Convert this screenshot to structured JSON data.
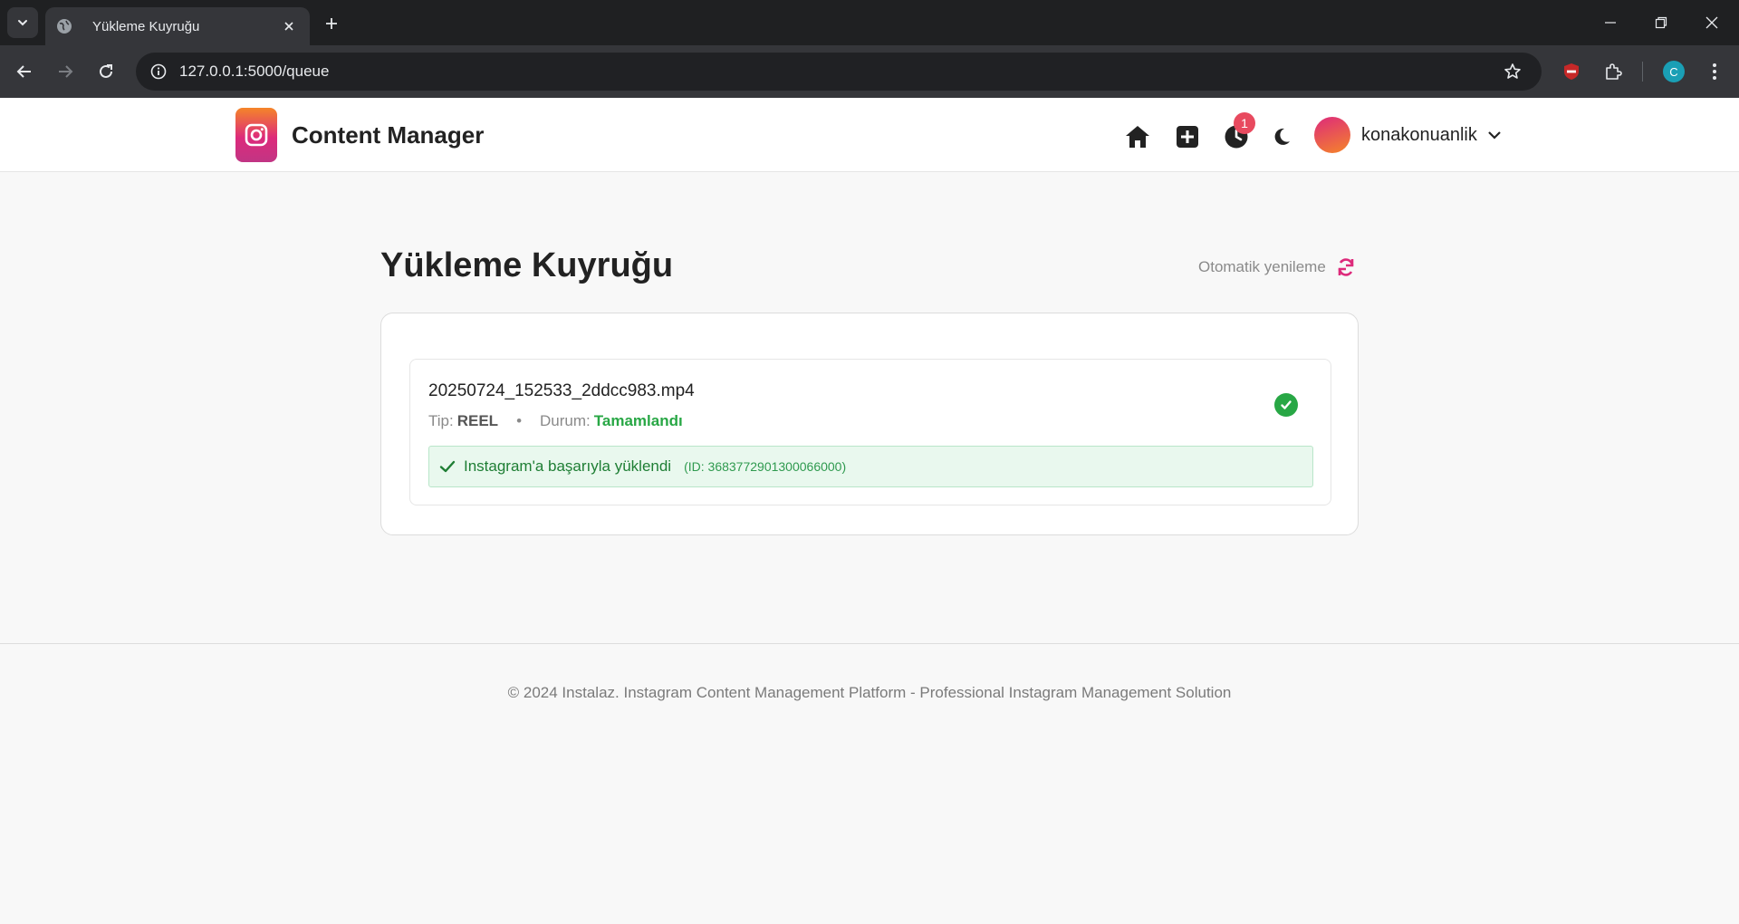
{
  "browser": {
    "tab_title": "Yükleme Kuyruğu",
    "url": "127.0.0.1:5000/queue",
    "profile_initial": "C"
  },
  "header": {
    "brand": "Content Manager",
    "notification_count": "1",
    "username": "konakonuanlik",
    "icons": [
      "home-icon",
      "plus-square-icon",
      "clock-icon",
      "moon-icon",
      "chevron-down-icon"
    ]
  },
  "main": {
    "title": "Yükleme Kuyruğu",
    "auto_refresh_label": "Otomatik yenileme",
    "items": [
      {
        "filename": "20250724_152533_2ddcc983.mp4",
        "type_label": "Tip:",
        "type_value": "REEL",
        "separator": "•",
        "status_label": "Durum:",
        "status_value": "Tamamlandı",
        "success_message": "Instagram'a başarıyla yüklendi",
        "post_id": "(ID: 3683772901300066000)"
      }
    ]
  },
  "footer": {
    "text": "© 2024 Instalaz. Instagram Content Management Platform - Professional Instagram Management Solution"
  },
  "colors": {
    "accent_gradient": [
      "#f58529",
      "#dd2a7b",
      "#c13584"
    ],
    "success": "#28a745",
    "badge": "#e84a5f"
  }
}
